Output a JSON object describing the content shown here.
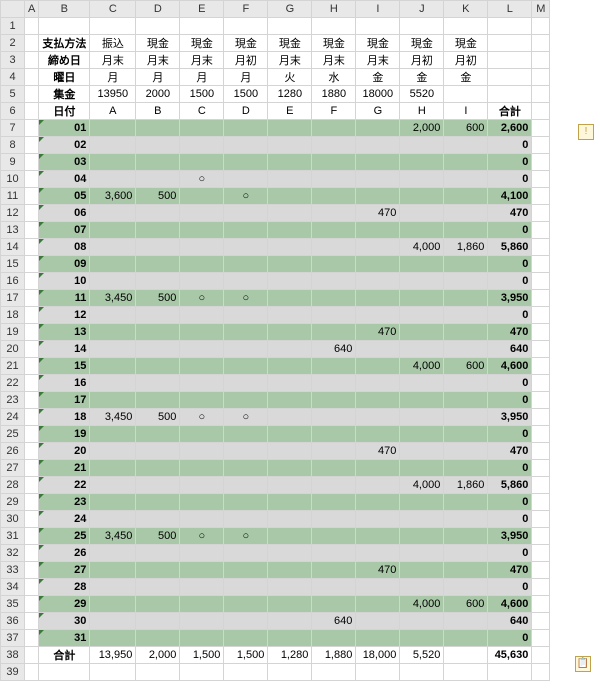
{
  "columns": [
    "A",
    "B",
    "C",
    "D",
    "E",
    "F",
    "G",
    "H",
    "I",
    "J",
    "K",
    "L",
    "M"
  ],
  "header_rows": [
    {
      "n": 2,
      "label": "支払方法",
      "vals": [
        "振込",
        "現金",
        "現金",
        "現金",
        "現金",
        "現金",
        "現金",
        "現金",
        "現金"
      ]
    },
    {
      "n": 3,
      "label": "締め日",
      "vals": [
        "月末",
        "月末",
        "月末",
        "月初",
        "月末",
        "月末",
        "月末",
        "月初",
        "月初"
      ]
    },
    {
      "n": 4,
      "label": "曜日",
      "vals": [
        "月",
        "月",
        "月",
        "月",
        "火",
        "水",
        "金",
        "金",
        "金"
      ]
    },
    {
      "n": 5,
      "label": "集金",
      "vals": [
        "13950",
        "2000",
        "1500",
        "1500",
        "1280",
        "1880",
        "18000",
        "5520",
        ""
      ]
    },
    {
      "n": 6,
      "label": "日付",
      "vals": [
        "A",
        "B",
        "C",
        "D",
        "E",
        "F",
        "G",
        "H",
        "I"
      ],
      "sum": "合計"
    }
  ],
  "data_rows": [
    {
      "n": 7,
      "day": "01",
      "g": true,
      "c": {
        "J": "2,000",
        "K": "600"
      },
      "s": "2,600",
      "tag": true
    },
    {
      "n": 8,
      "day": "02",
      "g": false,
      "c": {},
      "s": "0"
    },
    {
      "n": 9,
      "day": "03",
      "g": true,
      "c": {},
      "s": "0"
    },
    {
      "n": 10,
      "day": "04",
      "g": false,
      "c": {
        "E": "○"
      },
      "s": "0"
    },
    {
      "n": 11,
      "day": "05",
      "g": true,
      "c": {
        "C": "3,600",
        "D": "500",
        "F": "○"
      },
      "s": "4,100"
    },
    {
      "n": 12,
      "day": "06",
      "g": false,
      "c": {
        "I": "470"
      },
      "s": "470"
    },
    {
      "n": 13,
      "day": "07",
      "g": true,
      "c": {},
      "s": "0"
    },
    {
      "n": 14,
      "day": "08",
      "g": false,
      "c": {
        "J": "4,000",
        "K": "1,860"
      },
      "s": "5,860"
    },
    {
      "n": 15,
      "day": "09",
      "g": true,
      "c": {},
      "s": "0"
    },
    {
      "n": 16,
      "day": "10",
      "g": false,
      "c": {},
      "s": "0"
    },
    {
      "n": 17,
      "day": "11",
      "g": true,
      "c": {
        "C": "3,450",
        "D": "500",
        "E": "○",
        "F": "○"
      },
      "s": "3,950"
    },
    {
      "n": 18,
      "day": "12",
      "g": false,
      "c": {},
      "s": "0"
    },
    {
      "n": 19,
      "day": "13",
      "g": true,
      "c": {
        "I": "470"
      },
      "s": "470"
    },
    {
      "n": 20,
      "day": "14",
      "g": false,
      "c": {
        "H": "640"
      },
      "s": "640"
    },
    {
      "n": 21,
      "day": "15",
      "g": true,
      "c": {
        "J": "4,000",
        "K": "600"
      },
      "s": "4,600"
    },
    {
      "n": 22,
      "day": "16",
      "g": false,
      "c": {},
      "s": "0"
    },
    {
      "n": 23,
      "day": "17",
      "g": true,
      "c": {},
      "s": "0"
    },
    {
      "n": 24,
      "day": "18",
      "g": false,
      "c": {
        "C": "3,450",
        "D": "500",
        "E": "○",
        "F": "○"
      },
      "s": "3,950"
    },
    {
      "n": 25,
      "day": "19",
      "g": true,
      "c": {},
      "s": "0"
    },
    {
      "n": 26,
      "day": "20",
      "g": false,
      "c": {
        "I": "470"
      },
      "s": "470"
    },
    {
      "n": 27,
      "day": "21",
      "g": true,
      "c": {},
      "s": "0"
    },
    {
      "n": 28,
      "day": "22",
      "g": false,
      "c": {
        "J": "4,000",
        "K": "1,860"
      },
      "s": "5,860"
    },
    {
      "n": 29,
      "day": "23",
      "g": true,
      "c": {},
      "s": "0"
    },
    {
      "n": 30,
      "day": "24",
      "g": false,
      "c": {},
      "s": "0"
    },
    {
      "n": 31,
      "day": "25",
      "g": true,
      "c": {
        "C": "3,450",
        "D": "500",
        "E": "○",
        "F": "○"
      },
      "s": "3,950"
    },
    {
      "n": 32,
      "day": "26",
      "g": false,
      "c": {},
      "s": "0"
    },
    {
      "n": 33,
      "day": "27",
      "g": true,
      "c": {
        "I": "470"
      },
      "s": "470"
    },
    {
      "n": 34,
      "day": "28",
      "g": false,
      "c": {},
      "s": "0"
    },
    {
      "n": 35,
      "day": "29",
      "g": true,
      "c": {
        "J": "4,000",
        "K": "600"
      },
      "s": "4,600"
    },
    {
      "n": 36,
      "day": "30",
      "g": false,
      "c": {
        "H": "640"
      },
      "s": "640"
    },
    {
      "n": 37,
      "day": "31",
      "g": true,
      "c": {},
      "s": "0"
    }
  ],
  "totals": {
    "n": 38,
    "label": "合計",
    "vals": [
      "13,950",
      "2,000",
      "1,500",
      "1,500",
      "1,280",
      "1,880",
      "18,000",
      "5,520",
      ""
    ],
    "sum": "45,630"
  },
  "blank_top": 1,
  "blank_bottom": 39,
  "smart_tag_icon": "!",
  "paste_tag_icon": "📋"
}
